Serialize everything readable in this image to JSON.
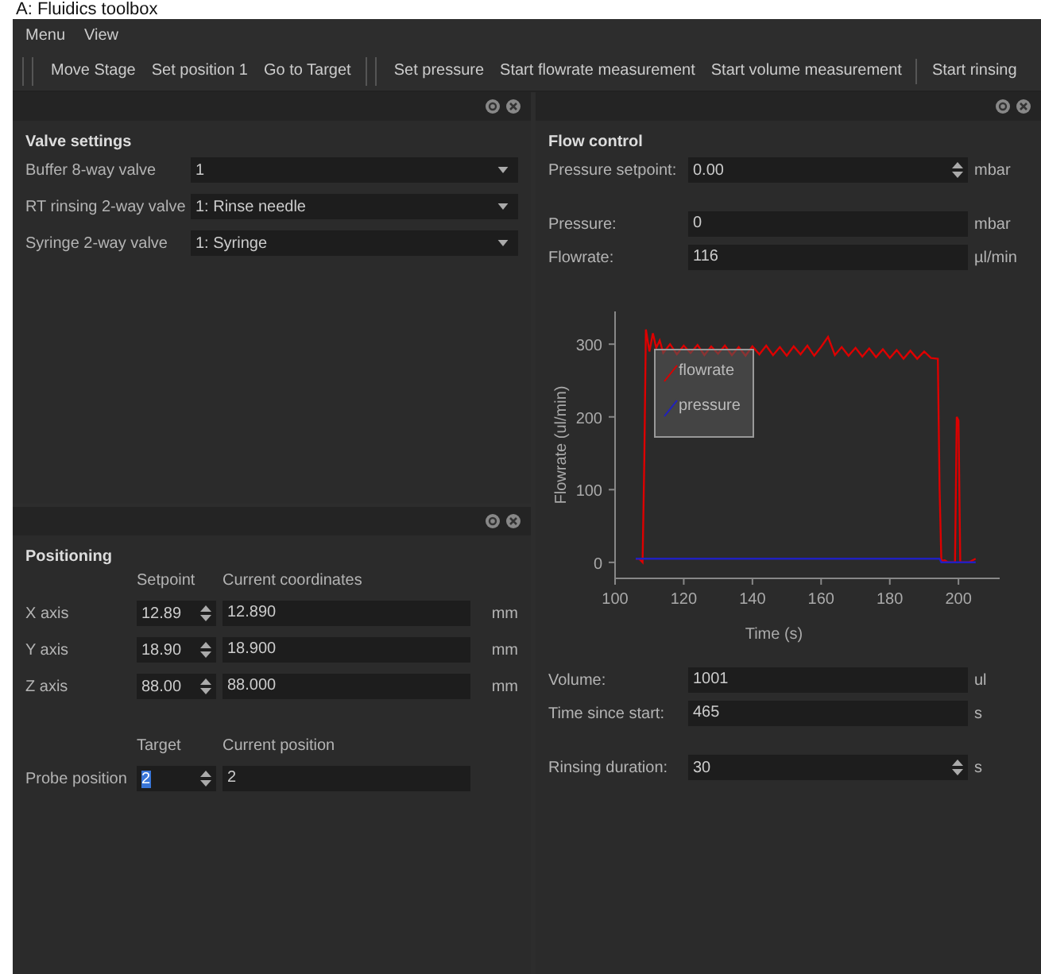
{
  "heading": "A: Fluidics toolbox",
  "menu": [
    {
      "label": "Menu"
    },
    {
      "label": "View"
    }
  ],
  "toolbar": [
    {
      "kind": "handle",
      "items": [
        "Move Stage",
        "Set position 1",
        "Go to Target"
      ]
    },
    {
      "kind": "handle",
      "items": [
        "Set pressure",
        "Start flowrate measurement",
        "Start volume measurement"
      ]
    },
    {
      "kind": "separator",
      "items": [
        "Start rinsing"
      ]
    }
  ],
  "valve_settings": {
    "title": "Valve settings",
    "rows": [
      {
        "label": "Buffer 8-way valve",
        "value": "1"
      },
      {
        "label": "RT rinsing 2-way valve",
        "value": "1: Rinse needle"
      },
      {
        "label": "Syringe 2-way valve",
        "value": "1: Syringe"
      }
    ]
  },
  "positioning": {
    "title": "Positioning",
    "headers": [
      "Setpoint",
      "Current coordinates"
    ],
    "axes": [
      {
        "label": "X axis",
        "setpoint": "12.89",
        "current": "12.890",
        "unit": "mm"
      },
      {
        "label": "Y axis",
        "setpoint": "18.90",
        "current": "18.900",
        "unit": "mm"
      },
      {
        "label": "Z axis",
        "setpoint": "88.00",
        "current": "88.000",
        "unit": "mm"
      }
    ],
    "probe_headers": [
      "Target",
      "Current position"
    ],
    "probe": {
      "label": "Probe position",
      "target": "2",
      "target_highlighted": true,
      "current": "2"
    }
  },
  "flow_control": {
    "title": "Flow control",
    "groups": [
      [
        {
          "kind": "spin",
          "label": "Pressure setpoint:",
          "value": "0.00",
          "unit": "mbar"
        }
      ],
      [
        {
          "kind": "field",
          "label": "Pressure:",
          "value": "0",
          "unit": "mbar"
        },
        {
          "kind": "field",
          "label": "Flowrate:",
          "value": "116",
          "unit": "µl/min"
        }
      ],
      [
        {
          "kind": "chart"
        }
      ],
      [
        {
          "kind": "field",
          "label": "Volume:",
          "value": "1001",
          "unit": "ul"
        },
        {
          "kind": "field",
          "label": "Time since start:",
          "value": "465",
          "unit": "s"
        }
      ],
      [
        {
          "kind": "spin",
          "label": "Rinsing duration:",
          "value": "30",
          "unit": "s"
        }
      ]
    ],
    "chart_data": {
      "type": "line",
      "xlabel": "Time (s)",
      "ylabel": "Flowrate (ul/min)",
      "x": [
        106,
        107,
        108,
        108.5,
        109,
        110,
        111,
        112,
        113,
        114,
        116,
        118,
        120,
        122,
        124,
        126,
        128,
        130,
        132,
        134,
        136,
        138,
        140,
        142,
        144,
        146,
        148,
        150,
        152,
        154,
        156,
        158,
        160,
        162,
        164,
        166,
        168,
        170,
        172,
        174,
        176,
        178,
        180,
        182,
        184,
        186,
        188,
        190,
        192,
        194,
        194.5,
        195,
        196,
        197,
        199,
        199.5,
        200,
        200.5,
        203,
        205
      ],
      "series": [
        {
          "name": "flowrate",
          "color": "#dd0000",
          "values": [
            5,
            5,
            0,
            140,
            320,
            290,
            315,
            295,
            305,
            288,
            300,
            286,
            298,
            288,
            299,
            285,
            297,
            287,
            298,
            285,
            296,
            284,
            297,
            286,
            298,
            285,
            296,
            284,
            297,
            286,
            298,
            284,
            296,
            310,
            285,
            296,
            284,
            295,
            283,
            294,
            282,
            293,
            281,
            292,
            280,
            291,
            280,
            290,
            281,
            280,
            100,
            2,
            3,
            0,
            0,
            200,
            195,
            0,
            0,
            5
          ]
        },
        {
          "name": "pressure",
          "color": "#2020c0",
          "values": [
            5,
            5,
            5,
            5,
            5,
            5,
            5,
            5,
            5,
            5,
            5,
            5,
            5,
            5,
            5,
            5,
            5,
            5,
            5,
            5,
            5,
            5,
            5,
            5,
            5,
            5,
            5,
            5,
            5,
            5,
            5,
            5,
            5,
            5,
            5,
            5,
            5,
            5,
            5,
            5,
            5,
            5,
            5,
            5,
            5,
            5,
            5,
            5,
            5,
            5,
            5,
            0,
            0,
            0,
            0,
            0,
            0,
            0,
            0,
            0
          ]
        }
      ],
      "legend": "upper left",
      "xlim": [
        100,
        212
      ],
      "ylim": [
        -22,
        345
      ],
      "xticks": [
        100,
        120,
        140,
        160,
        180,
        200
      ],
      "yticks": [
        0,
        100,
        200,
        300
      ]
    }
  }
}
